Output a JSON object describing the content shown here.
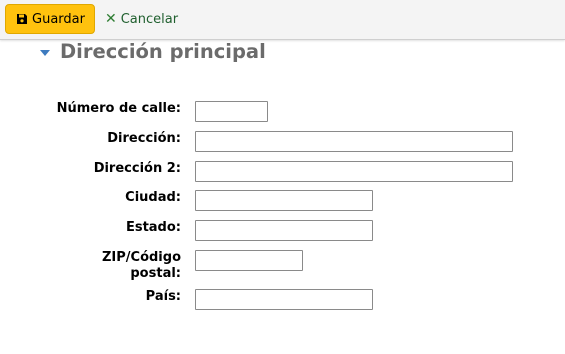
{
  "toolbar": {
    "save_label": "Guardar",
    "save_icon": "floppy-disk-icon",
    "cancel_label": "Cancelar",
    "cancel_icon": "x-icon",
    "save_color": "#ffc20e",
    "cancel_color": "#2e7d32"
  },
  "section": {
    "title": "Dirección principal",
    "caret_icon": "caret-down-icon",
    "caret_color": "#3e7bbf"
  },
  "form": {
    "street_number": {
      "label": "Número de calle:",
      "value": ""
    },
    "address": {
      "label": "Dirección:",
      "value": ""
    },
    "address2": {
      "label": "Dirección 2:",
      "value": ""
    },
    "city": {
      "label": "Ciudad:",
      "value": ""
    },
    "state": {
      "label": "Estado:",
      "value": ""
    },
    "zip": {
      "label_line1": "ZIP/Código",
      "label_line2": "postal:",
      "value": ""
    },
    "country": {
      "label": "País:",
      "value": ""
    }
  }
}
